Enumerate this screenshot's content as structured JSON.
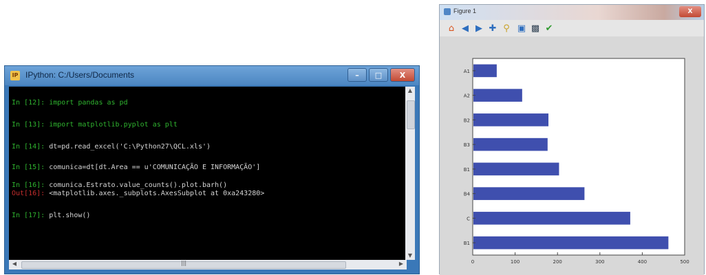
{
  "ipython": {
    "title": "IPython: C:/Users/Documents",
    "icon": "ipython-logo-icon",
    "controls": {
      "minimize": "–",
      "maximize": "□",
      "close": "X"
    },
    "lines": [
      {
        "prompt": "In [12]:",
        "code": "import pandas as pd"
      },
      {
        "prompt": "In [13]:",
        "code": "import matplotlib.pyplot as plt"
      },
      {
        "prompt": "In [14]:",
        "code": "dt=pd.read_excel('C:\\Python27\\QCL.xls')"
      },
      {
        "prompt": "In [15]:",
        "code": "comunica=dt[dt.Area == u'COMUNICAÇÃO E INFORMAÇÃO']"
      },
      {
        "prompt": "In [16]:",
        "code": "comunica.Estrato.value_counts().plot.barh()"
      },
      {
        "prompt": "Out[16]:",
        "code": "<matplotlib.axes._subplots.AxesSubplot at 0xa243280>"
      },
      {
        "prompt": "In [17]:",
        "code": "plt.show()"
      }
    ]
  },
  "figure": {
    "title": "Figure 1",
    "toolbar": [
      "home-icon",
      "back-arrow-icon",
      "forward-arrow-icon",
      "pan-icon",
      "zoom-icon",
      "subplots-icon",
      "save-icon",
      "edit-icon"
    ],
    "colors": {
      "bar": "#3f4fae",
      "axes_bg": "#ffffff",
      "figure_bg": "#d8d8d8"
    }
  },
  "chart_data": {
    "type": "bar",
    "orientation": "horizontal",
    "categories": [
      "B1",
      "C",
      "B4",
      "B1",
      "B3",
      "B2",
      "A2",
      "A1"
    ],
    "values": [
      460,
      370,
      262,
      202,
      175,
      177,
      115,
      55
    ],
    "xticks": [
      "0",
      "100",
      "200",
      "300",
      "400",
      "500"
    ],
    "xlim": [
      0,
      500
    ],
    "bar_color": "#3f4fae"
  }
}
